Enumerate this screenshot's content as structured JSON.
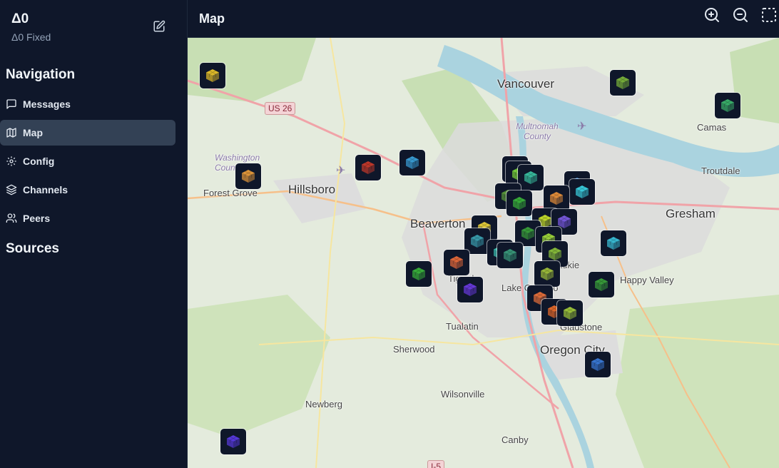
{
  "node": {
    "name": "Δ0",
    "status": "Δ0 Fixed"
  },
  "navigation": {
    "title": "Navigation",
    "items": [
      {
        "label": "Messages",
        "icon": "message-square-icon",
        "active": false
      },
      {
        "label": "Map",
        "icon": "map-icon",
        "active": true
      },
      {
        "label": "Config",
        "icon": "gear-icon",
        "active": false
      },
      {
        "label": "Channels",
        "icon": "layers-icon",
        "active": false
      },
      {
        "label": "Peers",
        "icon": "users-icon",
        "active": false
      }
    ]
  },
  "sources": {
    "title": "Sources"
  },
  "header": {
    "title": "Map",
    "tools": [
      "zoom-in-icon",
      "zoom-out-icon",
      "select-area-icon"
    ]
  },
  "map": {
    "places": {
      "vancouver": "Vancouver",
      "hillsboro": "Hillsboro",
      "forest_grove": "Forest Grove",
      "beaverton": "Beaverton",
      "gresham": "Gresham",
      "camas": "Camas",
      "troutdale": "Troutdale",
      "happy_valley": "Happy Valley",
      "tualatin": "Tualatin",
      "sherwood": "Sherwood",
      "oregon_city": "Oregon City",
      "gladstone": "Gladstone",
      "wilsonville": "Wilsonville",
      "newberg": "Newberg",
      "canby": "Canby",
      "lake_oswego": "Lake Oswego",
      "milwaukie": "Milwaukie",
      "tigard": "Tigard",
      "washington_county": "Washington County",
      "multnomah_county": "Multnomah County"
    },
    "shields": {
      "us26": "US 26",
      "i5": "I-5"
    },
    "colors": {
      "water": "#aad3df",
      "land": "#e4ebdd",
      "urban": "#dcdcdc",
      "forest": "#c8dfb4",
      "road": "#f0a3a8"
    }
  }
}
